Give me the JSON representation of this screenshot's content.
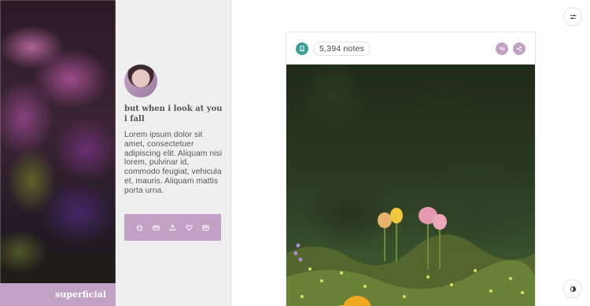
{
  "left_panel": {
    "caption": "superficial"
  },
  "sidebar": {
    "title": "but when i look at you i fall",
    "description": "Lorem ipsum dolor sit amet, consectetuer adipiscing elit. Aliquam nisi lorem, pulvinar id, commodo feugiat, vehicula et, mauris. Aliquam mattis porta urna.",
    "nav_icons": [
      "home-icon",
      "message-icon",
      "upload-icon",
      "heart-icon",
      "archive-icon"
    ]
  },
  "post": {
    "notes": "5,394 notes"
  },
  "colors": {
    "accent": "#c1a1c4",
    "bookmark": "#3d9f96",
    "sidebar_bg": "#efefef"
  }
}
